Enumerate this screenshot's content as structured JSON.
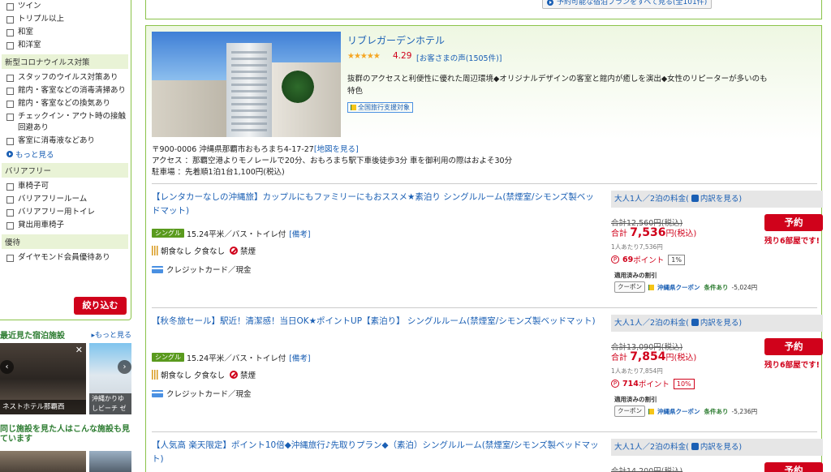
{
  "sidebar": {
    "room_types": [
      "ツイン",
      "トリプル以上",
      "和室",
      "和洋室"
    ],
    "covid_heading": "新型コロナウイルス対策",
    "covid_items": [
      "スタッフのウイルス対策あり",
      "館内・客室などの消毒清掃あり",
      "館内・客室などの換気あり",
      "チェックイン・アウト時の接触回避あり",
      "客室に消毒液などあり"
    ],
    "more_label": "もっと見る",
    "barrier_heading": "バリアフリー",
    "barrier_items": [
      "車椅子可",
      "バリアフリールーム",
      "バリアフリー用トイレ",
      "貸出用車椅子"
    ],
    "perk_heading": "優待",
    "perk_items": [
      "ダイヤモンド会員優待あり"
    ],
    "narrow_button": "絞り込む",
    "recent_title": "最近見た宿泊施設",
    "recent_more": "もっと見る",
    "recent_items": [
      {
        "name": "ネストホテル那覇西"
      },
      {
        "name": "沖縄かりゆしビーチ ゼス那覇く"
      }
    ],
    "similar_title": "同じ施設を見た人はこんな施設も見ています"
  },
  "top": {
    "all_plans": "予約可能な宿泊プランをすべて見る(全101件)"
  },
  "hotel": {
    "name": "リブレガーデンホテル",
    "stars": "★★★★★",
    "rating": "4.29",
    "reviews": "[お客さまの声(1505件)]",
    "description": "抜群のアクセスと利便性に優れた周辺環境◆オリジナルデザインの客室と館内が癒しを演出◆女性のリピーターが多いのも特色",
    "campaign": "全国旅行支援対象",
    "address": "〒900-0006 沖縄県那覇市おもろまち4-17-27",
    "map_link": "[地図を見る]",
    "access": "アクセス ：那覇空港よりモノレールで20分、おもろまち駅下車後徒歩3分 車を御利用の際はおよそ30分",
    "parking": "駐車場 ：先着順1泊1台1,100円(税込)"
  },
  "plans": [
    {
      "title": "【レンタカーなしの沖縄旅】カップルにもファミリーにもおススメ★素泊り シングルルーム(禁煙室/シモンズ製ベッドマット)",
      "room_tag": "シングル",
      "room_info": "15.24平米／バス・トイレ付",
      "notes_link": "[備考]",
      "meals": "朝食なし 夕食なし",
      "smoking": "禁煙",
      "payment": "クレジットカード／現金",
      "price_head": "大人1人／2泊の料金",
      "breakdown": "内訳を見る",
      "original": "合計12,560円(税込)",
      "total_prefix": "合計",
      "total": "7,536",
      "total_suffix": "円(税込)",
      "per_person": "1人あたり7,536円",
      "points": "69",
      "points_label": "ポイント",
      "pct": "1%",
      "pct_red": false,
      "applied": "適用済みの割引",
      "coupon_btn": "クーポン",
      "coupon_name": "沖縄県クーポン",
      "coupon_cond": "条件あり",
      "coupon_amount": "-5,024円",
      "reserve": "予約",
      "rooms_left": "残り6部屋です!"
    },
    {
      "title": "【秋冬旅セール】駅近！清潔感！当日OK★ポイントUP【素泊り】 シングルルーム(禁煙室/シモンズ製ベッドマット)",
      "room_tag": "シングル",
      "room_info": "15.24平米／バス・トイレ付",
      "notes_link": "[備考]",
      "meals": "朝食なし 夕食なし",
      "smoking": "禁煙",
      "payment": "クレジットカード／現金",
      "price_head": "大人1人／2泊の料金",
      "breakdown": "内訳を見る",
      "original": "合計13,090円(税込)",
      "total_prefix": "合計",
      "total": "7,854",
      "total_suffix": "円(税込)",
      "per_person": "1人あたり7,854円",
      "points": "714",
      "points_label": "ポイント",
      "pct": "10%",
      "pct_red": true,
      "applied": "適用済みの割引",
      "coupon_btn": "クーポン",
      "coupon_name": "沖縄県クーポン",
      "coupon_cond": "条件あり",
      "coupon_amount": "-5,236円",
      "reserve": "予約",
      "rooms_left": "残り6部屋です!"
    },
    {
      "title": "【人気高 楽天限定】ポイント10倍◆沖縄旅行♪先取りプラン◆（素泊）シングルルーム(禁煙室/シモンズ製ベッドマット)",
      "price_head": "大人1人／2泊の料金",
      "breakdown": "内訳を見る",
      "original": "合計14,200円(税込)",
      "reserve": "予約"
    }
  ],
  "colors": {
    "accent_green": "#8bc34a",
    "reserve_red": "#d0021b",
    "link_blue": "#1a5fb4"
  }
}
